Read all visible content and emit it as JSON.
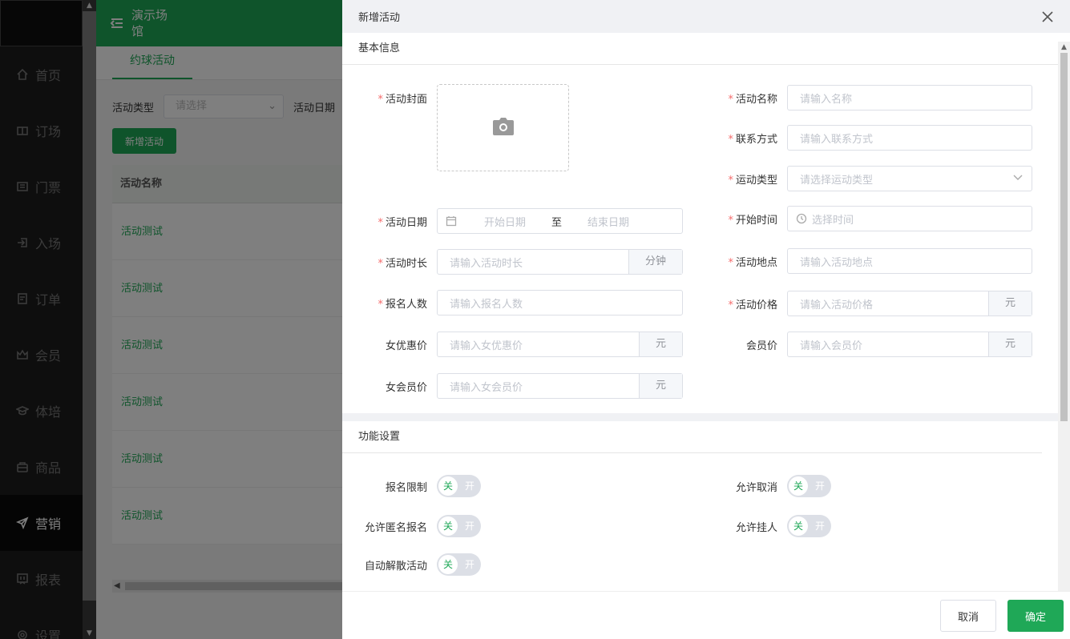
{
  "nav": {
    "items": [
      {
        "label": "首页",
        "icon": "home-icon"
      },
      {
        "label": "订场",
        "icon": "court-icon"
      },
      {
        "label": "门票",
        "icon": "ticket-icon"
      },
      {
        "label": "入场",
        "icon": "enter-icon"
      },
      {
        "label": "订单",
        "icon": "order-icon"
      },
      {
        "label": "会员",
        "icon": "crown-icon"
      },
      {
        "label": "体培",
        "icon": "training-icon"
      },
      {
        "label": "商品",
        "icon": "bag-icon"
      },
      {
        "label": "营销",
        "icon": "paper-plane-icon"
      },
      {
        "label": "报表",
        "icon": "report-icon"
      },
      {
        "label": "设置",
        "icon": "settings-icon"
      }
    ],
    "active": "营销"
  },
  "header": {
    "venue_line1": "演示场",
    "venue_line2": "馆"
  },
  "tabs": [
    {
      "label": "约球活动"
    }
  ],
  "filter": {
    "type_label": "活动类型",
    "type_placeholder": "请选择",
    "date_label": "活动日期"
  },
  "add_button": "新增活动",
  "table": {
    "header": "活动名称",
    "rows": [
      "活动测试",
      "活动测试",
      "活动测试",
      "活动测试",
      "活动测试",
      "活动测试"
    ]
  },
  "drawer": {
    "title": "新增活动",
    "section_basic": "基本信息",
    "section_features": "功能设置",
    "fields": {
      "cover": {
        "label": "活动封面"
      },
      "name": {
        "label": "活动名称",
        "placeholder": "请输入名称"
      },
      "contact": {
        "label": "联系方式",
        "placeholder": "请输入联系方式"
      },
      "sport_type": {
        "label": "运动类型",
        "placeholder": "请选择运动类型"
      },
      "date": {
        "label": "活动日期",
        "start": "开始日期",
        "sep": "至",
        "end": "结束日期"
      },
      "start_time": {
        "label": "开始时间",
        "placeholder": "选择时间"
      },
      "duration": {
        "label": "活动时长",
        "placeholder": "请输入活动时长",
        "suffix": "分钟"
      },
      "location": {
        "label": "活动地点",
        "placeholder": "请输入活动地点"
      },
      "signup_count": {
        "label": "报名人数",
        "placeholder": "请输入报名人数"
      },
      "price": {
        "label": "活动价格",
        "placeholder": "请输入活动价格",
        "suffix": "元"
      },
      "female_discount": {
        "label": "女优惠价",
        "placeholder": "请输入女优惠价",
        "suffix": "元"
      },
      "member_price": {
        "label": "会员价",
        "placeholder": "请输入会员价",
        "suffix": "元"
      },
      "female_member_price": {
        "label": "女会员价",
        "placeholder": "请输入女会员价",
        "suffix": "元"
      }
    },
    "switches": {
      "off_text": "关",
      "on_text": "开",
      "signup_limit": "报名限制",
      "allow_cancel": "允许取消",
      "allow_anonymous": "允许匿名报名",
      "allow_hold": "允许挂人",
      "auto_dissolve": "自动解散活动"
    },
    "cancel": "取消",
    "confirm": "确定"
  },
  "colors": {
    "brand": "#1fa857",
    "required": "#f56c6c"
  }
}
